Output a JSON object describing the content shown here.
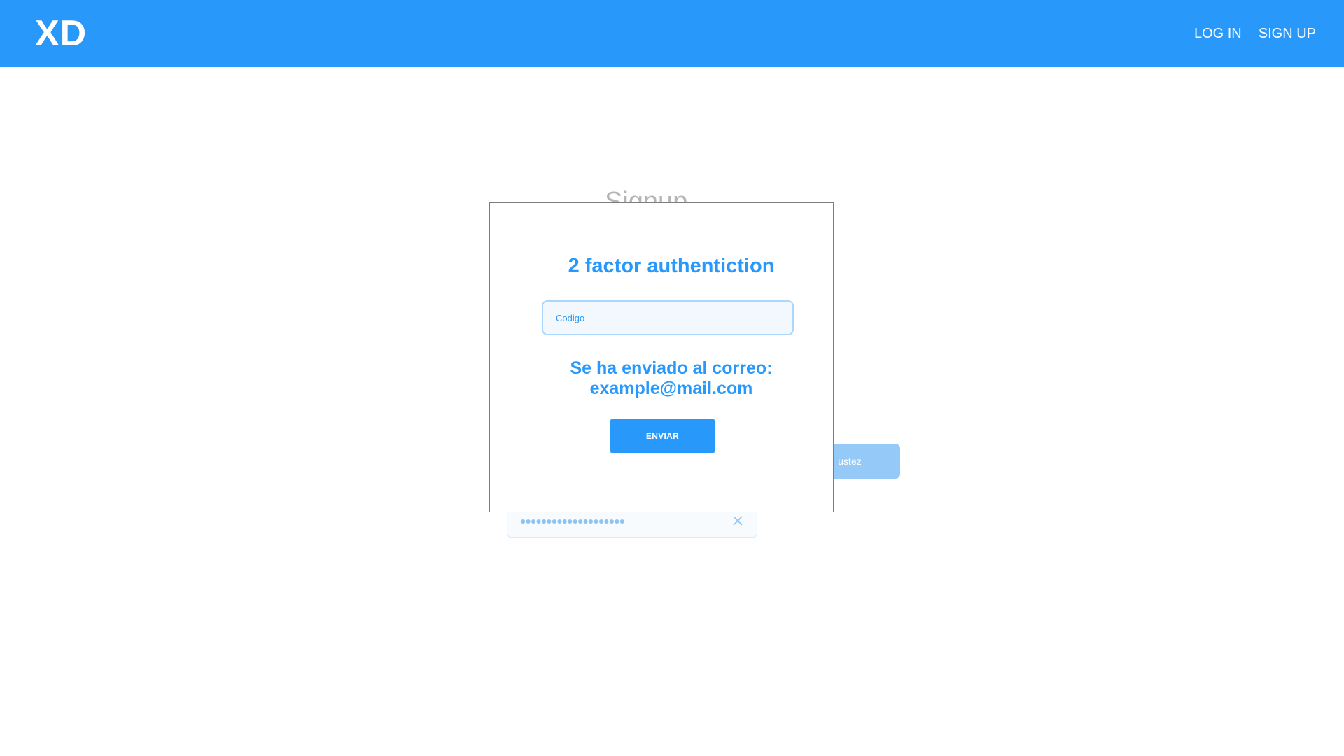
{
  "header": {
    "logo": "XD",
    "nav": {
      "login_label": "LOG IN",
      "signup_label": "SIGN UP"
    }
  },
  "background_form": {
    "title": "Signup",
    "button_label": "ustez",
    "password_value": "●●●●●●●●●●●●●●●●●●●●"
  },
  "modal": {
    "title": "2 factor authentiction",
    "code_placeholder": "Codigo",
    "sent_line1": "Se ha enviado al correo:",
    "sent_line2": "example@mail.com",
    "send_button_label": "ENVIAR"
  },
  "colors": {
    "brand": "#2899fb",
    "header_bg": "#2899fb",
    "disabled_button": "#94c9f8"
  }
}
